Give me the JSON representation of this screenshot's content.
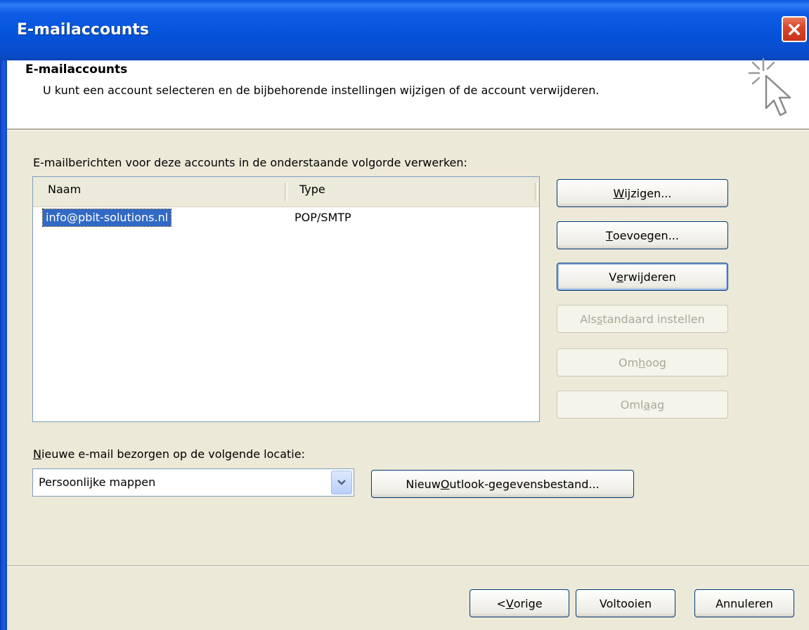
{
  "window": {
    "title": "E-mailaccounts"
  },
  "header": {
    "title": "E-mailaccounts",
    "description": "U kunt een account selecteren en de bijbehorende instellingen wijzigen of de account verwijderen."
  },
  "accounts": {
    "label": "E-mailberichten voor deze accounts in de onderstaande volgorde verwerken:",
    "columns": [
      "Naam",
      "Type"
    ],
    "rows": [
      {
        "name": "info@pbit-solutions.nl",
        "type": "POP/SMTP",
        "selected": true
      }
    ]
  },
  "buttons": {
    "wijzigen": {
      "pre": "",
      "key": "W",
      "post": "ijzigen..."
    },
    "toevoegen": {
      "pre": "",
      "key": "T",
      "post": "oevoegen..."
    },
    "verwijderen": {
      "pre": "V",
      "key": "e",
      "post": "rwijderen"
    },
    "standaard": {
      "pre": "Als ",
      "key": "s",
      "post": "tandaard instellen",
      "disabled": true
    },
    "omhoog": {
      "pre": "Om",
      "key": "h",
      "post": "oog",
      "disabled": true
    },
    "omlaag": {
      "pre": "Oml",
      "key": "a",
      "post": "ag",
      "disabled": true
    }
  },
  "delivery": {
    "label_key": "N",
    "label_rest": "ieuwe e-mail bezorgen op de volgende locatie:",
    "selected": "Persoonlijke mappen",
    "new_file_button": {
      "pre": "Nieuw ",
      "key": "O",
      "post": "utlook-gegevensbestand..."
    }
  },
  "footer": {
    "back": {
      "pre": "< ",
      "key": "V",
      "post": "orige"
    },
    "finish": "Voltooien",
    "cancel": "Annuleren"
  },
  "icons": {
    "close": "close-icon",
    "header": "cursor-sparkle-icon",
    "dropdown": "chevron-down-icon"
  },
  "colors": {
    "titlebar": "#0552d9",
    "selection": "#316ac5",
    "dialog_bg": "#ece9d8",
    "close_button": "#d9482a",
    "disabled_text": "#aca899"
  }
}
